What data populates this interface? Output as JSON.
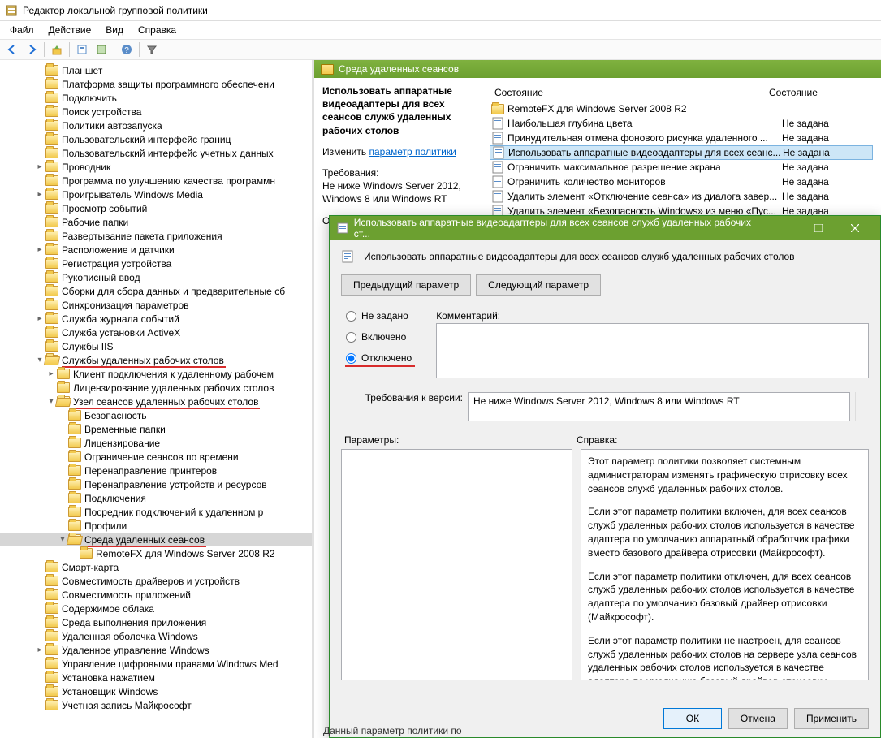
{
  "window": {
    "title": "Редактор локальной групповой политики"
  },
  "menubar": [
    "Файл",
    "Действие",
    "Вид",
    "Справка"
  ],
  "tree": [
    {
      "indent": 3,
      "label": "Планшет",
      "exp": ""
    },
    {
      "indent": 3,
      "label": "Платформа защиты программного обеспечени",
      "exp": ""
    },
    {
      "indent": 3,
      "label": "Подключить",
      "exp": ""
    },
    {
      "indent": 3,
      "label": "Поиск устройства",
      "exp": ""
    },
    {
      "indent": 3,
      "label": "Политики автозапуска",
      "exp": ""
    },
    {
      "indent": 3,
      "label": "Пользовательский интерфейс границ",
      "exp": ""
    },
    {
      "indent": 3,
      "label": "Пользовательский интерфейс учетных данных",
      "exp": ""
    },
    {
      "indent": 3,
      "label": "Проводник",
      "exp": ">"
    },
    {
      "indent": 3,
      "label": "Программа по улучшению качества программн",
      "exp": ""
    },
    {
      "indent": 3,
      "label": "Проигрыватель Windows Media",
      "exp": ">"
    },
    {
      "indent": 3,
      "label": "Просмотр событий",
      "exp": ""
    },
    {
      "indent": 3,
      "label": "Рабочие папки",
      "exp": ""
    },
    {
      "indent": 3,
      "label": "Развертывание пакета приложения",
      "exp": ""
    },
    {
      "indent": 3,
      "label": "Расположение и датчики",
      "exp": ">"
    },
    {
      "indent": 3,
      "label": "Регистрация устройства",
      "exp": ""
    },
    {
      "indent": 3,
      "label": "Рукописный ввод",
      "exp": ""
    },
    {
      "indent": 3,
      "label": "Сборки для сбора данных и предварительные сб",
      "exp": ""
    },
    {
      "indent": 3,
      "label": "Синхронизация параметров",
      "exp": ""
    },
    {
      "indent": 3,
      "label": "Служба журнала событий",
      "exp": ">"
    },
    {
      "indent": 3,
      "label": "Служба установки ActiveX",
      "exp": ""
    },
    {
      "indent": 3,
      "label": "Службы IIS",
      "exp": ""
    },
    {
      "indent": 3,
      "label": "Службы удаленных рабочих столов",
      "exp": "v",
      "open": true,
      "red": true
    },
    {
      "indent": 4,
      "label": "Клиент подключения к удаленному рабочем",
      "exp": ">"
    },
    {
      "indent": 4,
      "label": "Лицензирование удаленных рабочих столов",
      "exp": ""
    },
    {
      "indent": 4,
      "label": "Узел сеансов удаленных рабочих столов",
      "exp": "v",
      "open": true,
      "red": true
    },
    {
      "indent": 5,
      "label": "Безопасность",
      "exp": ""
    },
    {
      "indent": 5,
      "label": "Временные папки",
      "exp": ""
    },
    {
      "indent": 5,
      "label": "Лицензирование",
      "exp": ""
    },
    {
      "indent": 5,
      "label": "Ограничение сеансов по времени",
      "exp": ""
    },
    {
      "indent": 5,
      "label": "Перенаправление принтеров",
      "exp": ""
    },
    {
      "indent": 5,
      "label": "Перенаправление устройств и ресурсов",
      "exp": ""
    },
    {
      "indent": 5,
      "label": "Подключения",
      "exp": ""
    },
    {
      "indent": 5,
      "label": "Посредник подключений к удаленном р",
      "exp": ""
    },
    {
      "indent": 5,
      "label": "Профили",
      "exp": ""
    },
    {
      "indent": 5,
      "label": "Среда удаленных сеансов",
      "exp": "v",
      "open": true,
      "red": true,
      "selected": true
    },
    {
      "indent": 6,
      "label": "RemoteFX для Windows Server 2008 R2",
      "exp": ""
    },
    {
      "indent": 3,
      "label": "Смарт-карта",
      "exp": ""
    },
    {
      "indent": 3,
      "label": "Совместимость драйверов и устройств",
      "exp": ""
    },
    {
      "indent": 3,
      "label": "Совместимость приложений",
      "exp": ""
    },
    {
      "indent": 3,
      "label": "Содержимое облака",
      "exp": ""
    },
    {
      "indent": 3,
      "label": "Среда выполнения приложения",
      "exp": ""
    },
    {
      "indent": 3,
      "label": "Удаленная оболочка Windows",
      "exp": ""
    },
    {
      "indent": 3,
      "label": "Удаленное управление Windows",
      "exp": ">"
    },
    {
      "indent": 3,
      "label": "Управление цифровыми правами Windows Med",
      "exp": ""
    },
    {
      "indent": 3,
      "label": "Установка нажатием",
      "exp": ""
    },
    {
      "indent": 3,
      "label": "Установщик Windows",
      "exp": ""
    },
    {
      "indent": 3,
      "label": "Учетная запись Майкрософт",
      "exp": ""
    }
  ],
  "content_header": "Среда удаленных сеансов",
  "content_left": {
    "title": "Использовать аппаратные видеоадаптеры для всех сеансов служб удаленных рабочих столов",
    "edit": "Изменить",
    "edit_link": "параметр политики",
    "req_label": "Требования:",
    "req_text": "Не ниже Windows Server 2012, Windows 8 или Windows RT",
    "desc_label": "Описание:"
  },
  "list_header": {
    "col1": "",
    "col2": "Состояние",
    "col0": "Состояние"
  },
  "list_rows": [
    {
      "name": "RemoteFX для Windows Server 2008 R2",
      "state": "",
      "icon": "folder"
    },
    {
      "name": "Наибольшая глубина цвета",
      "state": "Не задана",
      "icon": "setting"
    },
    {
      "name": "Принудительная отмена фонового рисунка удаленного ...",
      "state": "Не задана",
      "icon": "setting"
    },
    {
      "name": "Использовать аппаратные видеоадаптеры для всех сеанс...",
      "state": "Не задана",
      "icon": "setting",
      "selected": true
    },
    {
      "name": "Ограничить максимальное разрешение экрана",
      "state": "Не задана",
      "icon": "setting"
    },
    {
      "name": "Ограничить количество мониторов",
      "state": "Не задана",
      "icon": "setting"
    },
    {
      "name": "Удалить элемент «Отключение сеанса» из диалога завер...",
      "state": "Не задана",
      "icon": "setting"
    },
    {
      "name": "Удалить элемент «Безопасность Windows» из меню «Пус...",
      "state": "Не задана",
      "icon": "setting"
    }
  ],
  "dialog": {
    "title": "Использовать аппаратные видеоадаптеры для всех сеансов служб удаленных рабочих ст...",
    "name": "Использовать аппаратные видеоадаптеры для всех сеансов служб удаленных рабочих столов",
    "prev": "Предыдущий параметр",
    "next": "Следующий параметр",
    "opt_notconf": "Не задано",
    "opt_enabled": "Включено",
    "opt_disabled": "Отключено",
    "comment_label": "Комментарий:",
    "req_label": "Требования к версии:",
    "req_text": "Не ниже Windows Server 2012, Windows 8 или Windows RT",
    "params_label": "Параметры:",
    "help_label": "Справка:",
    "help_p1": "Этот параметр политики позволяет системным администраторам изменять графическую отрисовку всех сеансов служб удаленных рабочих столов.",
    "help_p2": "Если этот параметр политики включен, для всех сеансов служб удаленных рабочих столов используется в качестве адаптера по умолчанию аппаратный обработчик графики вместо базового драйвера отрисовки (Майкрософт).",
    "help_p3": "Если этот параметр политики отключен, для всех сеансов служб удаленных рабочих столов используется в качестве адаптера по умолчанию базовый драйвер отрисовки (Майкрософт).",
    "help_p4": "Если этот параметр политики не настроен, для сеансов служб удаленных рабочих столов на сервере узла сеансов удаленных рабочих столов используется в качестве адаптера по умолчанию базовый драйвер отрисовки (Майкрософт). Во всех других случаях для сеансов служб удаленных рабочих",
    "ok": "ОК",
    "cancel": "Отмена",
    "apply": "Применить"
  },
  "footer": "Данный параметр политики по"
}
